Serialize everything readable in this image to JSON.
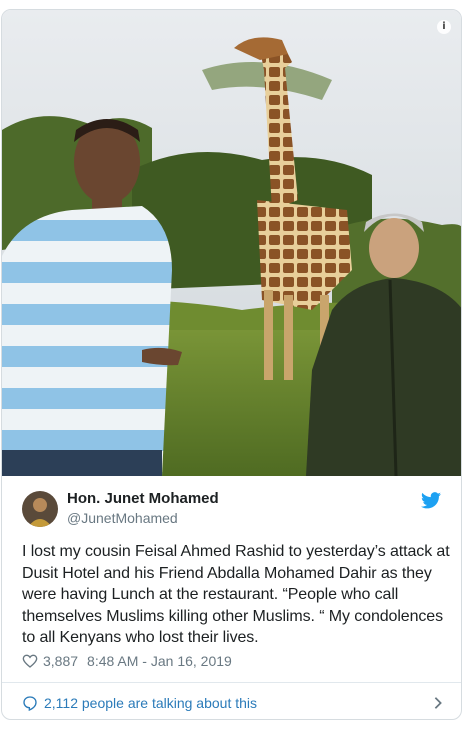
{
  "embed": {
    "info_icon": "info-icon",
    "photo_alt": "Two men standing in front of a giraffe in the bush",
    "author": {
      "display_name": "Hon. Junet Mohamed",
      "handle": "@JunetMohamed",
      "avatar_icon": "avatar"
    },
    "brand_icon": "twitter-bird-icon",
    "brand_color": "#1da1f2",
    "text": "I lost my cousin Feisal Ahmed Rashid to yesterday’s attack at Dusit Hotel and his Friend Abdalla Mohamed Dahir as they were having Lunch at the restaurant. “People who call themselves Muslims killing other Muslims. “ My condolences to all Kenyans who lost their lives.",
    "likes_icon": "heart-icon",
    "likes": "3,887",
    "timestamp": "8:48 AM - Jan 16, 2019",
    "conversation": {
      "icon": "speech-bubble-icon",
      "label": "2,112 people are talking about this",
      "chevron_icon": "chevron-right-icon"
    },
    "link_color": "#2b7bb9",
    "muted_color": "#697882"
  }
}
